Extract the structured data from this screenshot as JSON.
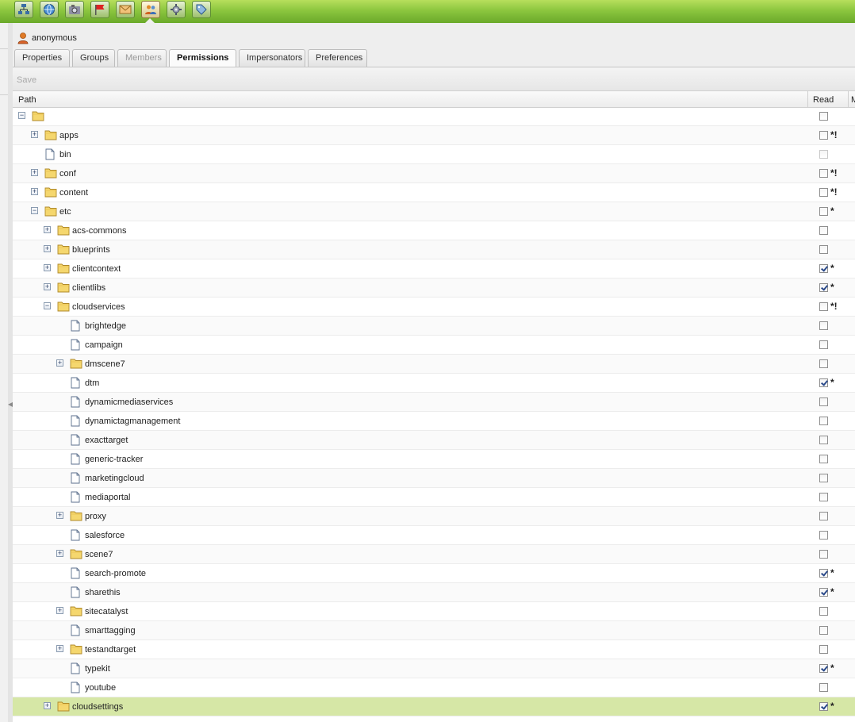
{
  "toolbar": {
    "buttons": [
      {
        "icon": "sitemap-icon"
      },
      {
        "icon": "globe-icon"
      },
      {
        "icon": "camera-icon"
      },
      {
        "icon": "campaign-flag-icon"
      },
      {
        "icon": "inbox-icon"
      },
      {
        "icon": "users-icon"
      },
      {
        "icon": "tools-icon"
      },
      {
        "icon": "tag-icon"
      }
    ],
    "active_index": 5
  },
  "user": {
    "name": "anonymous"
  },
  "tabs": [
    {
      "label": "Properties",
      "state": "normal"
    },
    {
      "label": "Groups",
      "state": "normal"
    },
    {
      "label": "Members",
      "state": "disabled"
    },
    {
      "label": "Permissions",
      "state": "active"
    },
    {
      "label": "Impersonators",
      "state": "normal"
    },
    {
      "label": "Preferences",
      "state": "normal"
    }
  ],
  "actions": {
    "save_label": "Save"
  },
  "grid": {
    "columns": {
      "path": "Path",
      "read": "Read",
      "next": "M"
    },
    "rows": [
      {
        "label": "",
        "level": 0,
        "type": "folder",
        "expander": "minus",
        "read": false,
        "mark": ""
      },
      {
        "label": "apps",
        "level": 1,
        "type": "folder",
        "expander": "plus",
        "read": false,
        "mark": "*!"
      },
      {
        "label": "bin",
        "level": 1,
        "type": "file",
        "expander": "",
        "read": false,
        "disabled": true,
        "mark": ""
      },
      {
        "label": "conf",
        "level": 1,
        "type": "folder",
        "expander": "plus",
        "read": false,
        "mark": "*!"
      },
      {
        "label": "content",
        "level": 1,
        "type": "folder",
        "expander": "plus",
        "read": false,
        "mark": "*!"
      },
      {
        "label": "etc",
        "level": 1,
        "type": "folder",
        "expander": "minus",
        "read": false,
        "mark": "*"
      },
      {
        "label": "acs-commons",
        "level": 2,
        "type": "folder",
        "expander": "plus",
        "read": false,
        "mark": ""
      },
      {
        "label": "blueprints",
        "level": 2,
        "type": "folder",
        "expander": "plus",
        "read": false,
        "mark": ""
      },
      {
        "label": "clientcontext",
        "level": 2,
        "type": "folder",
        "expander": "plus",
        "read": true,
        "mark": "*"
      },
      {
        "label": "clientlibs",
        "level": 2,
        "type": "folder",
        "expander": "plus",
        "read": true,
        "mark": "*"
      },
      {
        "label": "cloudservices",
        "level": 2,
        "type": "folder",
        "expander": "minus",
        "read": false,
        "mark": "*!"
      },
      {
        "label": "brightedge",
        "level": 3,
        "type": "file",
        "expander": "",
        "read": false,
        "mark": ""
      },
      {
        "label": "campaign",
        "level": 3,
        "type": "file",
        "expander": "",
        "read": false,
        "mark": ""
      },
      {
        "label": "dmscene7",
        "level": 3,
        "type": "folder",
        "expander": "plus",
        "read": false,
        "mark": ""
      },
      {
        "label": "dtm",
        "level": 3,
        "type": "file",
        "expander": "",
        "read": true,
        "mark": "*"
      },
      {
        "label": "dynamicmediaservices",
        "level": 3,
        "type": "file",
        "expander": "",
        "read": false,
        "mark": ""
      },
      {
        "label": "dynamictagmanagement",
        "level": 3,
        "type": "file",
        "expander": "",
        "read": false,
        "mark": ""
      },
      {
        "label": "exacttarget",
        "level": 3,
        "type": "file",
        "expander": "",
        "read": false,
        "mark": ""
      },
      {
        "label": "generic-tracker",
        "level": 3,
        "type": "file",
        "expander": "",
        "read": false,
        "mark": ""
      },
      {
        "label": "marketingcloud",
        "level": 3,
        "type": "file",
        "expander": "",
        "read": false,
        "mark": ""
      },
      {
        "label": "mediaportal",
        "level": 3,
        "type": "file",
        "expander": "",
        "read": false,
        "mark": ""
      },
      {
        "label": "proxy",
        "level": 3,
        "type": "folder",
        "expander": "plus",
        "read": false,
        "mark": ""
      },
      {
        "label": "salesforce",
        "level": 3,
        "type": "file",
        "expander": "",
        "read": false,
        "mark": ""
      },
      {
        "label": "scene7",
        "level": 3,
        "type": "folder",
        "expander": "plus",
        "read": false,
        "mark": ""
      },
      {
        "label": "search-promote",
        "level": 3,
        "type": "file",
        "expander": "",
        "read": true,
        "mark": "*"
      },
      {
        "label": "sharethis",
        "level": 3,
        "type": "file",
        "expander": "",
        "read": true,
        "mark": "*"
      },
      {
        "label": "sitecatalyst",
        "level": 3,
        "type": "folder",
        "expander": "plus",
        "read": false,
        "mark": ""
      },
      {
        "label": "smarttagging",
        "level": 3,
        "type": "file",
        "expander": "",
        "read": false,
        "mark": ""
      },
      {
        "label": "testandtarget",
        "level": 3,
        "type": "folder",
        "expander": "plus",
        "read": false,
        "mark": ""
      },
      {
        "label": "typekit",
        "level": 3,
        "type": "file",
        "expander": "",
        "read": true,
        "mark": "*"
      },
      {
        "label": "youtube",
        "level": 3,
        "type": "file",
        "expander": "",
        "read": false,
        "mark": ""
      },
      {
        "label": "cloudsettings",
        "level": 2,
        "type": "folder",
        "expander": "plus",
        "read": true,
        "mark": "*",
        "selected": true
      }
    ]
  },
  "colors": {
    "toolbar_green": "#8cc63f",
    "selected_row": "#d6e7a6",
    "folder_yellow": "#f5d76e"
  }
}
